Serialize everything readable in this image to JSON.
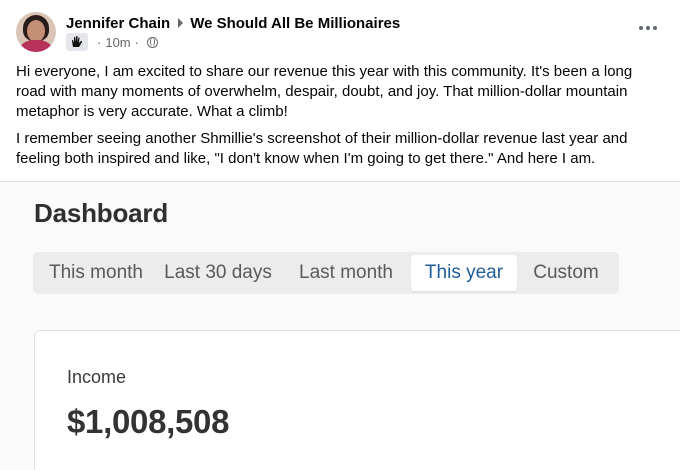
{
  "post": {
    "author": "Jennifer Chain",
    "group": "We Should All Be Millionaires",
    "time": "10m",
    "badge_icon": "hand-badge-icon",
    "privacy_icon": "globe-icon",
    "paragraphs": [
      "Hi everyone, I am excited to share our revenue this year with this community. It's been a long road with many moments of overwhelm, despair, doubt, and joy. That million-dollar mountain metaphor is very accurate. What a climb!",
      "I remember seeing another Shmillie's screenshot of their million-dollar revenue last year and feeling both inspired and like, \"I don't know when I'm going to get there.\" And here I am."
    ]
  },
  "dashboard": {
    "title": "Dashboard",
    "tabs": [
      {
        "label": "This month",
        "selected": false
      },
      {
        "label": "Last 30 days",
        "selected": false
      },
      {
        "label": "Last month",
        "selected": false
      },
      {
        "label": "This year",
        "selected": true
      },
      {
        "label": "Custom",
        "selected": false
      }
    ],
    "income_label": "Income",
    "income_value": "$1,008,508"
  },
  "colors": {
    "selected_tab_text": "#1f5e9c",
    "meta_text": "#65676b"
  }
}
